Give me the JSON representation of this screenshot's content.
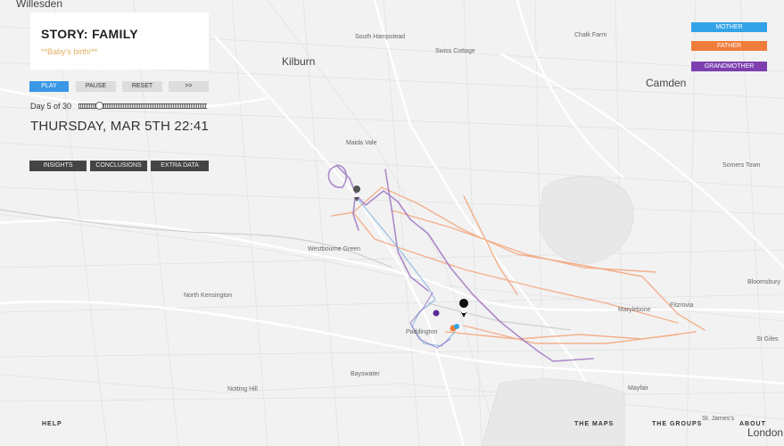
{
  "map": {
    "places": [
      {
        "name": "Willesden",
        "size": "big"
      },
      {
        "name": "South Hampstead",
        "size": "small"
      },
      {
        "name": "Swiss Cottage",
        "size": "small"
      },
      {
        "name": "Chalk Farm",
        "size": "small"
      },
      {
        "name": "Kilburn",
        "size": "big"
      },
      {
        "name": "Camden",
        "size": "big"
      },
      {
        "name": "Maida Vale",
        "size": "small"
      },
      {
        "name": "Somers Town",
        "size": "small"
      },
      {
        "name": "Westbourne Green",
        "size": "small"
      },
      {
        "name": "North Kensington",
        "size": "small"
      },
      {
        "name": "Bloomsbury",
        "size": "small"
      },
      {
        "name": "Fitzrovia",
        "size": "small"
      },
      {
        "name": "Marylebone",
        "size": "small"
      },
      {
        "name": "St Giles",
        "size": "small"
      },
      {
        "name": "Paddington",
        "size": "small"
      },
      {
        "name": "Bayswater",
        "size": "small"
      },
      {
        "name": "Notting Hill",
        "size": "small"
      },
      {
        "name": "Mayfair",
        "size": "small"
      },
      {
        "name": "St. James's",
        "size": "small"
      },
      {
        "name": "London",
        "size": "big"
      }
    ],
    "route_colors": {
      "mother": "#7fb2e0",
      "father": "#f3a57a",
      "grandmother": "#9a6fc0"
    }
  },
  "story": {
    "title": "STORY: FAMILY",
    "subtitle": "**Baby's birth!**"
  },
  "controls": {
    "play": "PLAY",
    "pause": "PAUSE",
    "reset": "RESET",
    "forward": ">>"
  },
  "timeline": {
    "day_label": "Day 5 of 30",
    "current_day": 5,
    "total_days": 30
  },
  "datetime": "THURSDAY, MAR 5TH 22:41",
  "tabs": {
    "insights": "INSIGHTS",
    "conclusions": "CONCLUSIONS",
    "extra": "EXTRA DATA"
  },
  "legend": [
    {
      "label": "MOTHER",
      "color": "#33a3e8"
    },
    {
      "label": "FATHER",
      "color": "#f07c3a"
    },
    {
      "label": "GRANDMOTHER",
      "color": "#7d3fb0"
    }
  ],
  "footer": {
    "help": "HELP",
    "maps": "THE MAPS",
    "groups": "THE GROUPS",
    "about": "ABOUT"
  }
}
